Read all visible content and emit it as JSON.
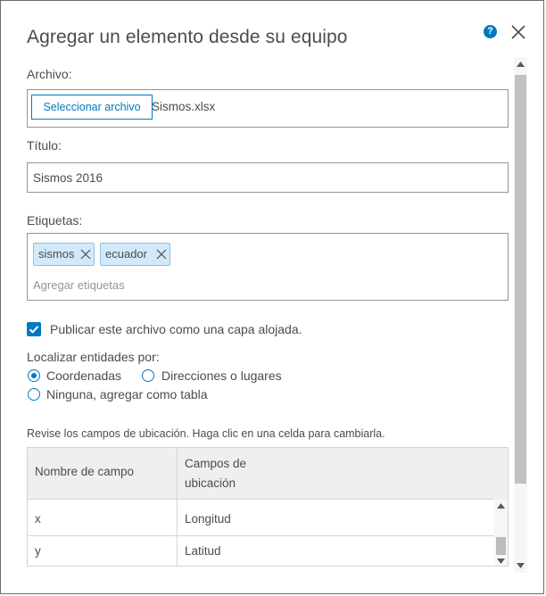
{
  "dialog": {
    "title": "Agregar un elemento desde su equipo",
    "help_icon": "question-mark-icon",
    "close_icon": "close-x-icon"
  },
  "file": {
    "label": "Archivo:",
    "button_label": "Seleccionar archivo",
    "file_name": "Sismos.xlsx"
  },
  "title_field": {
    "label": "Título:",
    "value": "Sismos 2016"
  },
  "tags": {
    "label": "Etiquetas:",
    "items": [
      {
        "label": "sismos"
      },
      {
        "label": "ecuador"
      }
    ],
    "placeholder": "Agregar etiquetas"
  },
  "publish": {
    "checked": true,
    "label": "Publicar este archivo como una capa alojada."
  },
  "locate": {
    "label": "Localizar entidades por:",
    "options": [
      {
        "label": "Coordenadas",
        "checked": true
      },
      {
        "label": "Direcciones o lugares",
        "checked": false
      },
      {
        "label": "Ninguna, agregar como tabla",
        "checked": false
      }
    ]
  },
  "fields_table": {
    "instructions": "Revise los campos de ubicación. Haga clic en una celda para cambiarla.",
    "headers": [
      "Nombre de campo",
      "Campos de ubicación"
    ],
    "rows": [
      [
        "x",
        "Longitud"
      ],
      [
        "y",
        "Latitud"
      ]
    ]
  },
  "colors": {
    "accent": "#0079c1",
    "tag_background": "#d2e9f9",
    "header_background": "#efefef"
  }
}
